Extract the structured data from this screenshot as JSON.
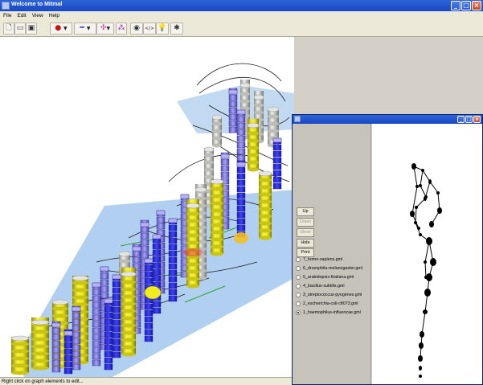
{
  "window": {
    "title": "Welcome to Mitmal"
  },
  "menu": {
    "items": [
      "File",
      "Edit",
      "View",
      "Help"
    ]
  },
  "toolbar": {
    "buttons": [
      {
        "icon": "new-icon"
      },
      {
        "icon": "open-icon"
      },
      {
        "icon": "save-icon"
      },
      {
        "icon": "node-color-icon"
      },
      {
        "icon": "edge-style-icon"
      },
      {
        "icon": "layout-icon"
      },
      {
        "icon": "nodes-icon"
      },
      {
        "icon": "find-icon"
      },
      {
        "icon": "html-export-icon"
      },
      {
        "icon": "lightbulb-icon"
      },
      {
        "icon": "settings-icon"
      }
    ],
    "node_color": "#cc1111",
    "edge_color": "#1f2fd0"
  },
  "status_bar": {
    "text": "Right click on graph elements to edit..."
  },
  "panel": {
    "buttons": {
      "up": "Up",
      "down": "Down",
      "show": "Show",
      "hide": "Hide",
      "print": "Print"
    },
    "files": [
      {
        "label": "7_homo-sapiens.gml",
        "selected": false
      },
      {
        "label": "6_drosophila-melanogaster.gml",
        "selected": false
      },
      {
        "label": "5_arabidopsis-thaliana.gml",
        "selected": false
      },
      {
        "label": "4_bacillus-subtilis.gml",
        "selected": false
      },
      {
        "label": "3_streptococcus-pyogenes.gml",
        "selected": false
      },
      {
        "label": "2_escherichia-coli-cft073.gml",
        "selected": false
      },
      {
        "label": "1_haemophilus-influenzae.gml",
        "selected": true
      }
    ]
  },
  "colors": {
    "plane": "#a9cbef",
    "stack_yellow": "#f2ee1a",
    "stack_purple": "#8a82e6",
    "stack_blue": "#2a2ef0",
    "cap_gray": "#dededc"
  }
}
